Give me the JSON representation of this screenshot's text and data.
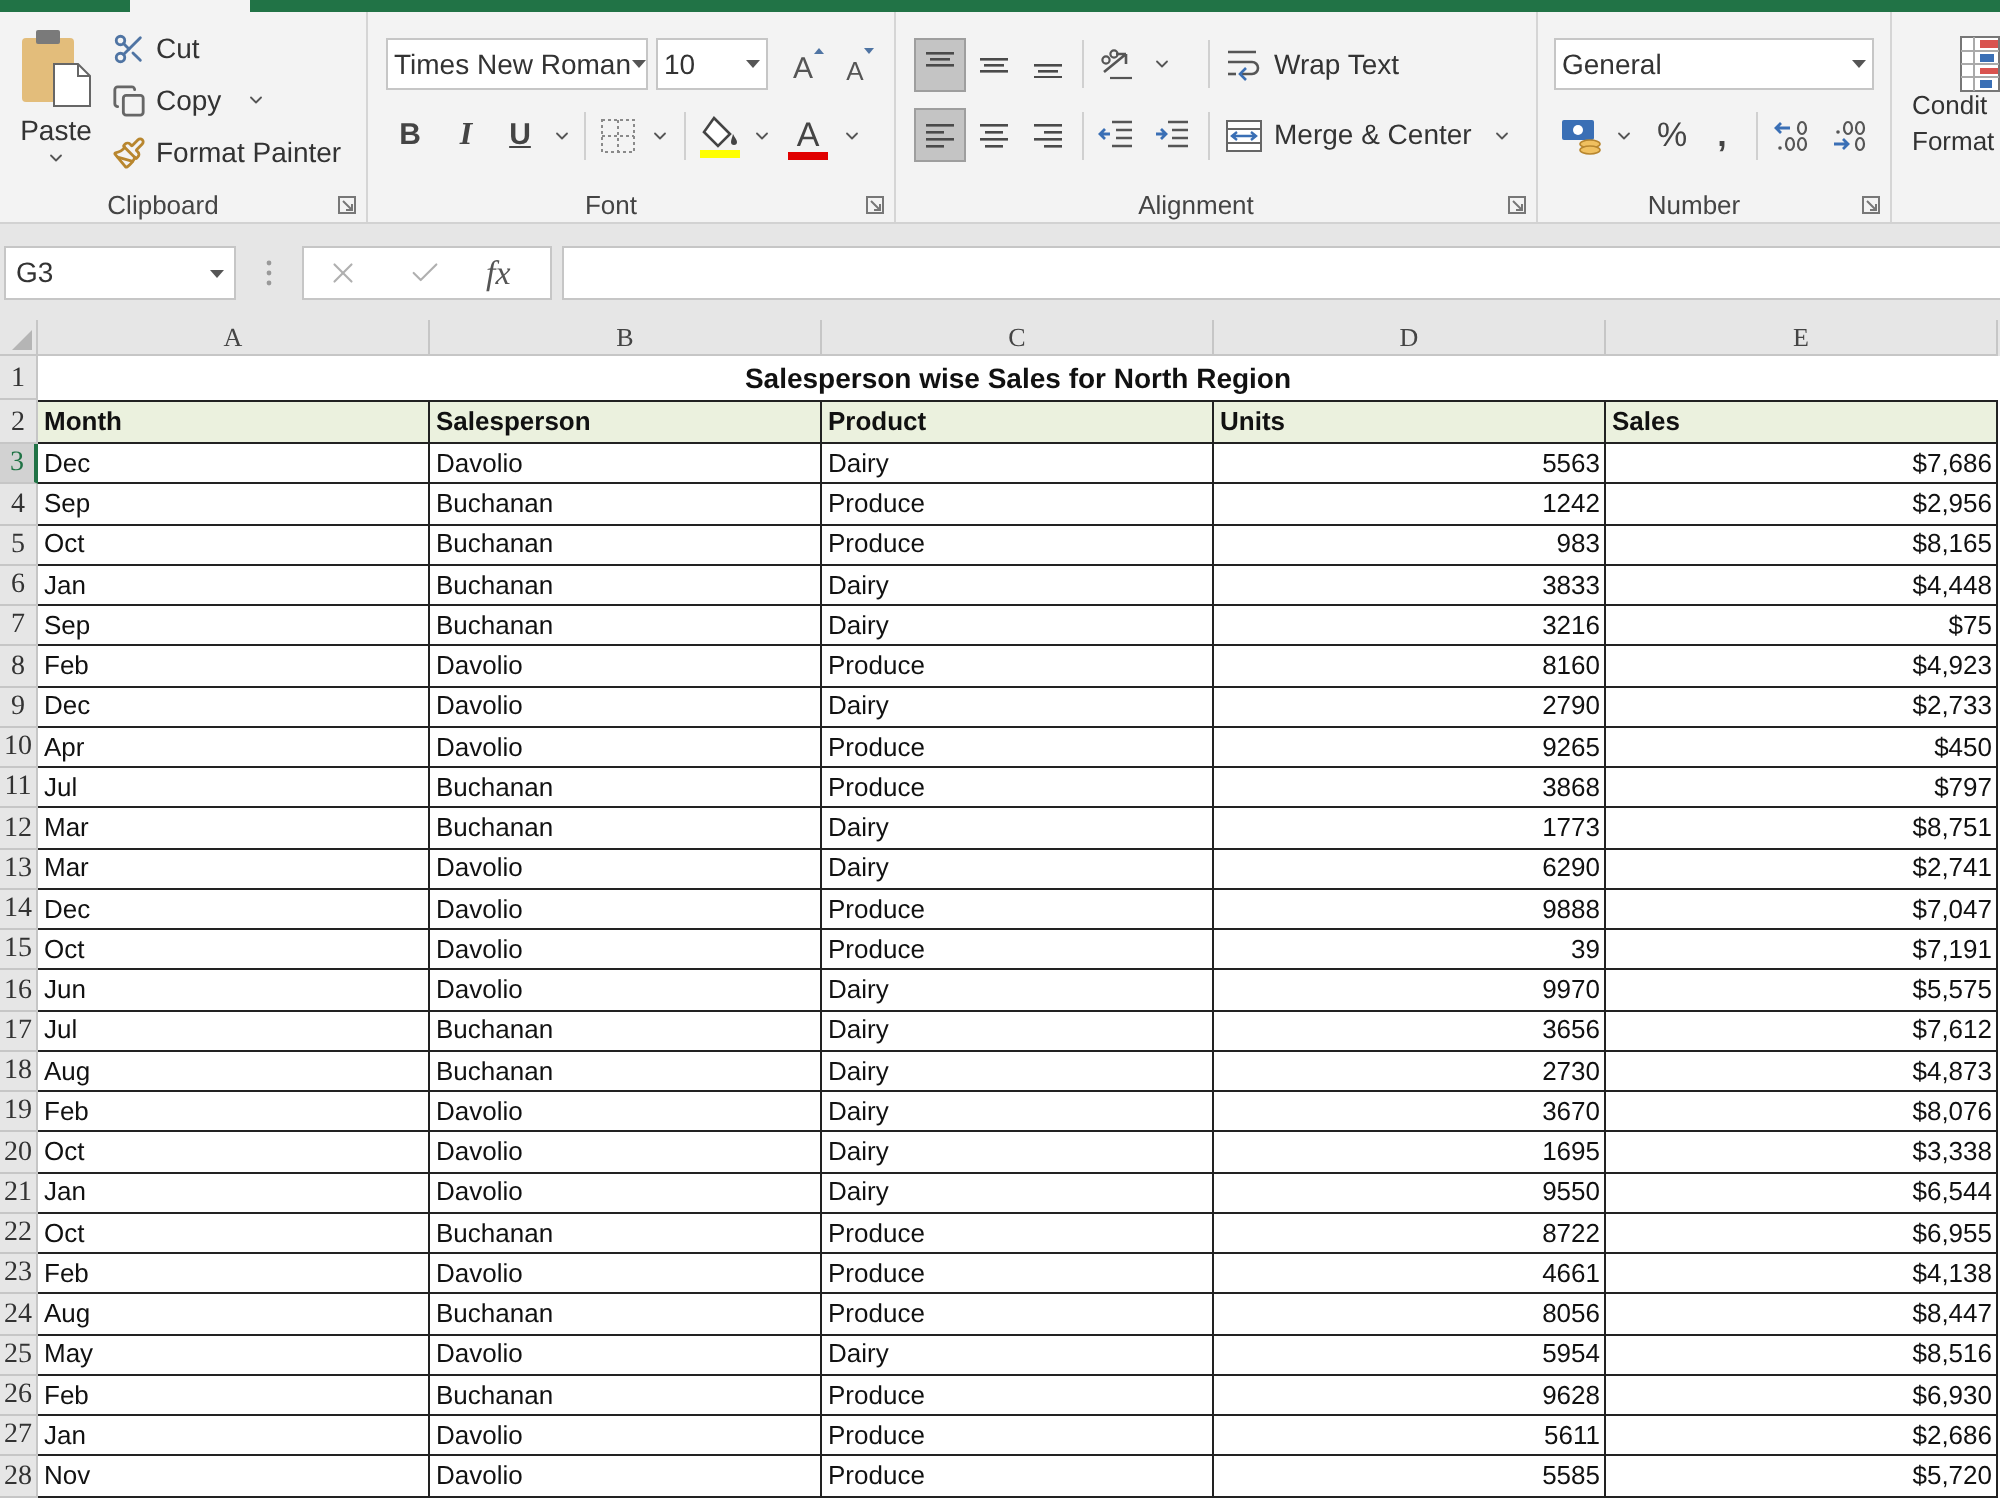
{
  "ribbon": {
    "clipboard": {
      "label": "Clipboard",
      "paste": "Paste",
      "cut": "Cut",
      "copy": "Copy",
      "format_painter": "Format Painter"
    },
    "font": {
      "label": "Font",
      "font_name": "Times New Roman",
      "font_size": "10",
      "grow_font": "A",
      "shrink_font": "A",
      "bold": "B",
      "italic": "I",
      "underline": "U",
      "font_color": "A"
    },
    "alignment": {
      "label": "Alignment",
      "vertical": [
        {
          "kind": "top",
          "selected": true
        },
        {
          "kind": "middle",
          "selected": false
        },
        {
          "kind": "bottom",
          "selected": false
        }
      ],
      "horizontal": [
        {
          "kind": "left",
          "selected": true
        },
        {
          "kind": "center",
          "selected": false
        },
        {
          "kind": "right",
          "selected": false
        }
      ],
      "wrap_text": "Wrap Text",
      "merge_center": "Merge & Center"
    },
    "number": {
      "label": "Number",
      "format": "General",
      "percent": "%",
      "comma": ","
    },
    "styles": {
      "conditional_formatting": [
        "Condit",
        "Format"
      ]
    }
  },
  "formula_bar": {
    "name_box": "G3",
    "function_label": "fx"
  },
  "sheet": {
    "columns": [
      "A",
      "B",
      "C",
      "D",
      "E"
    ],
    "rows": [
      {
        "number": "1",
        "kind": "title",
        "selected": false,
        "text": "Salesperson wise Sales for North Region"
      },
      {
        "number": "2",
        "kind": "header",
        "selected": false,
        "cells": [
          "Month",
          "Salesperson",
          "Product",
          "Units",
          "Sales"
        ]
      },
      {
        "number": "3",
        "kind": "data",
        "selected": true,
        "cells": [
          "Dec",
          "Davolio",
          "Dairy",
          "5563",
          "$7,686"
        ]
      },
      {
        "number": "4",
        "kind": "data",
        "selected": false,
        "cells": [
          "Sep",
          "Buchanan",
          "Produce",
          "1242",
          "$2,956"
        ]
      },
      {
        "number": "5",
        "kind": "data",
        "selected": false,
        "cells": [
          "Oct",
          "Buchanan",
          "Produce",
          "983",
          "$8,165"
        ]
      },
      {
        "number": "6",
        "kind": "data",
        "selected": false,
        "cells": [
          "Jan",
          "Buchanan",
          "Dairy",
          "3833",
          "$4,448"
        ]
      },
      {
        "number": "7",
        "kind": "data",
        "selected": false,
        "cells": [
          "Sep",
          "Buchanan",
          "Dairy",
          "3216",
          "$75"
        ]
      },
      {
        "number": "8",
        "kind": "data",
        "selected": false,
        "cells": [
          "Feb",
          "Davolio",
          "Produce",
          "8160",
          "$4,923"
        ]
      },
      {
        "number": "9",
        "kind": "data",
        "selected": false,
        "cells": [
          "Dec",
          "Davolio",
          "Dairy",
          "2790",
          "$2,733"
        ]
      },
      {
        "number": "10",
        "kind": "data",
        "selected": false,
        "cells": [
          "Apr",
          "Davolio",
          "Produce",
          "9265",
          "$450"
        ]
      },
      {
        "number": "11",
        "kind": "data",
        "selected": false,
        "cells": [
          "Jul",
          "Buchanan",
          "Produce",
          "3868",
          "$797"
        ]
      },
      {
        "number": "12",
        "kind": "data",
        "selected": false,
        "cells": [
          "Mar",
          "Buchanan",
          "Dairy",
          "1773",
          "$8,751"
        ]
      },
      {
        "number": "13",
        "kind": "data",
        "selected": false,
        "cells": [
          "Mar",
          "Davolio",
          "Dairy",
          "6290",
          "$2,741"
        ]
      },
      {
        "number": "14",
        "kind": "data",
        "selected": false,
        "cells": [
          "Dec",
          "Davolio",
          "Produce",
          "9888",
          "$7,047"
        ]
      },
      {
        "number": "15",
        "kind": "data",
        "selected": false,
        "cells": [
          "Oct",
          "Davolio",
          "Produce",
          "39",
          "$7,191"
        ]
      },
      {
        "number": "16",
        "kind": "data",
        "selected": false,
        "cells": [
          "Jun",
          "Davolio",
          "Dairy",
          "9970",
          "$5,575"
        ]
      },
      {
        "number": "17",
        "kind": "data",
        "selected": false,
        "cells": [
          "Jul",
          "Buchanan",
          "Dairy",
          "3656",
          "$7,612"
        ]
      },
      {
        "number": "18",
        "kind": "data",
        "selected": false,
        "cells": [
          "Aug",
          "Buchanan",
          "Dairy",
          "2730",
          "$4,873"
        ]
      },
      {
        "number": "19",
        "kind": "data",
        "selected": false,
        "cells": [
          "Feb",
          "Davolio",
          "Dairy",
          "3670",
          "$8,076"
        ]
      },
      {
        "number": "20",
        "kind": "data",
        "selected": false,
        "cells": [
          "Oct",
          "Davolio",
          "Dairy",
          "1695",
          "$3,338"
        ]
      },
      {
        "number": "21",
        "kind": "data",
        "selected": false,
        "cells": [
          "Jan",
          "Davolio",
          "Dairy",
          "9550",
          "$6,544"
        ]
      },
      {
        "number": "22",
        "kind": "data",
        "selected": false,
        "cells": [
          "Oct",
          "Buchanan",
          "Produce",
          "8722",
          "$6,955"
        ]
      },
      {
        "number": "23",
        "kind": "data",
        "selected": false,
        "cells": [
          "Feb",
          "Davolio",
          "Produce",
          "4661",
          "$4,138"
        ]
      },
      {
        "number": "24",
        "kind": "data",
        "selected": false,
        "cells": [
          "Aug",
          "Buchanan",
          "Produce",
          "8056",
          "$8,447"
        ]
      },
      {
        "number": "25",
        "kind": "data",
        "selected": false,
        "cells": [
          "May",
          "Davolio",
          "Dairy",
          "5954",
          "$8,516"
        ]
      },
      {
        "number": "26",
        "kind": "data",
        "selected": false,
        "cells": [
          "Feb",
          "Buchanan",
          "Produce",
          "9628",
          "$6,930"
        ]
      },
      {
        "number": "27",
        "kind": "data",
        "selected": false,
        "cells": [
          "Jan",
          "Davolio",
          "Produce",
          "5611",
          "$2,686"
        ]
      },
      {
        "number": "28",
        "kind": "data",
        "selected": false,
        "cells": [
          "Nov",
          "Davolio",
          "Produce",
          "5585",
          "$5,720"
        ]
      }
    ]
  }
}
